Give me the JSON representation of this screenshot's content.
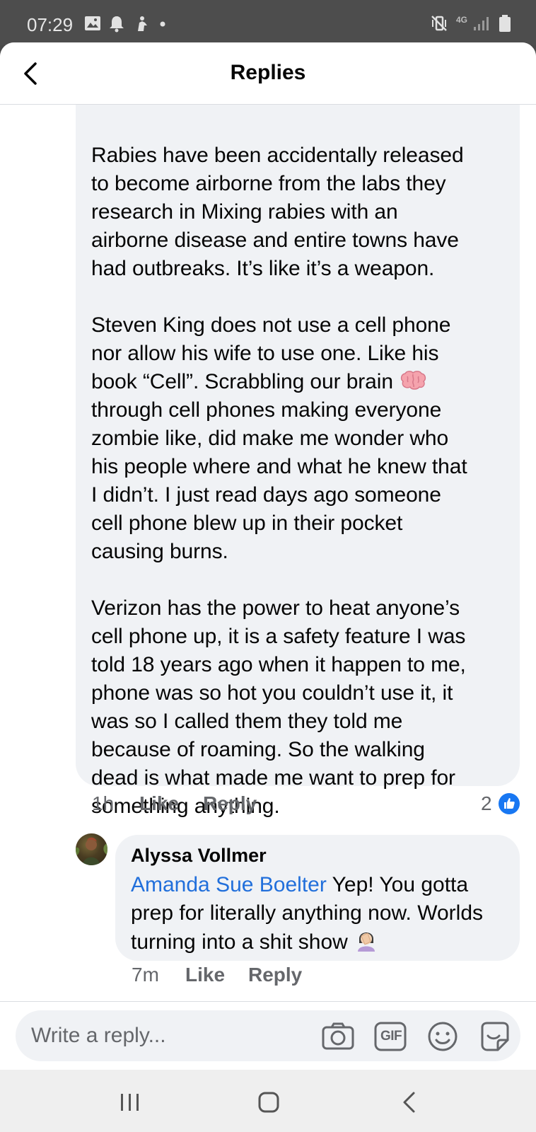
{
  "status_bar": {
    "time": "07:29",
    "left_icons": [
      "image-icon",
      "bell-icon",
      "gesture-icon",
      "dot-icon"
    ],
    "right_icons": [
      "mute-vibrate-icon",
      "4g-icon",
      "signal-icon",
      "battery-icon"
    ],
    "network_label": "4G"
  },
  "header": {
    "title": "Replies",
    "back_icon": "chevron-left-icon"
  },
  "parent_comment": {
    "paragraphs": [
      "Rabies have been accidentally released\nto become airborne from the labs they\nresearch in Mixing rabies with an\nairborne disease and entire towns have\nhad outbreaks. It’s like it’s a weapon.",
      "through cell phones making everyone\nzombie like, did make me wonder who\nhis people where and what he knew that\nI didn’t. I just read days ago someone\ncell phone blew up in their pocket\ncausing burns.",
      "Verizon has the power to heat anyone’s\ncell phone up, it is a safety feature I was\ntold 18 years ago when it happen to me,\nphone was so hot you couldn’t use it, it\nwas so I called them they told me\nbecause of roaming. So the walking\ndead is what made me want to prep for\nsomething anything."
    ],
    "para2_lead": "Steven King does not use a cell phone\nnor allow his wife to use one. Like his\nbook “Cell”. Scrabbling our brain ",
    "brain_emoji": "brain-icon",
    "time": "1h",
    "like_label": "Like",
    "reply_label": "Reply",
    "reaction_count": "2",
    "reaction_icon": "thumbs-up-icon"
  },
  "reply_comment": {
    "author": "Alyssa Vollmer",
    "mention": "Amanda Sue Boelter",
    "text_after_mention": " Yep! You gotta prep for literally anything now. Worlds turning into a shit show ",
    "emoji": "facepalm-icon",
    "time": "7m",
    "like_label": "Like",
    "reply_label": "Reply"
  },
  "composer": {
    "placeholder": "Write a reply...",
    "icons": [
      "camera-icon",
      "gif-icon",
      "emoji-icon",
      "sticker-icon"
    ],
    "gif_label": "GIF"
  },
  "nav_bar": {
    "icons": [
      "recents-icon",
      "home-icon",
      "back-icon"
    ]
  },
  "colors": {
    "accent": "#216fdb",
    "bubble": "#f0f2f5",
    "meta": "#65676b",
    "like_badge": "#1877f2"
  }
}
